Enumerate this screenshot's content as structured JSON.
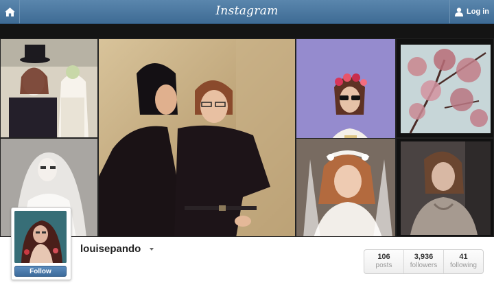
{
  "header": {
    "logo": "Instagram",
    "login_label": "Log in",
    "home_icon": "home-icon",
    "user_icon": "user-icon"
  },
  "colors": {
    "bar": "#3e6b94",
    "follow": "#4a7bab",
    "page": "#ffffff"
  },
  "photos": [
    {
      "name": "photo-tea-party-costume"
    },
    {
      "name": "photo-bride-veil-white"
    },
    {
      "name": "photo-two-women-posing"
    },
    {
      "name": "photo-flower-crown-sunglasses"
    },
    {
      "name": "photo-bride-tiara"
    },
    {
      "name": "photo-cherry-blossom-tree"
    },
    {
      "name": "photo-vintage-portrait"
    }
  ],
  "profile": {
    "username": "louisepando",
    "follow_label": "Follow",
    "stats": [
      {
        "value": "106",
        "label": "posts"
      },
      {
        "value": "3,936",
        "label": "followers"
      },
      {
        "value": "41",
        "label": "following"
      }
    ]
  }
}
